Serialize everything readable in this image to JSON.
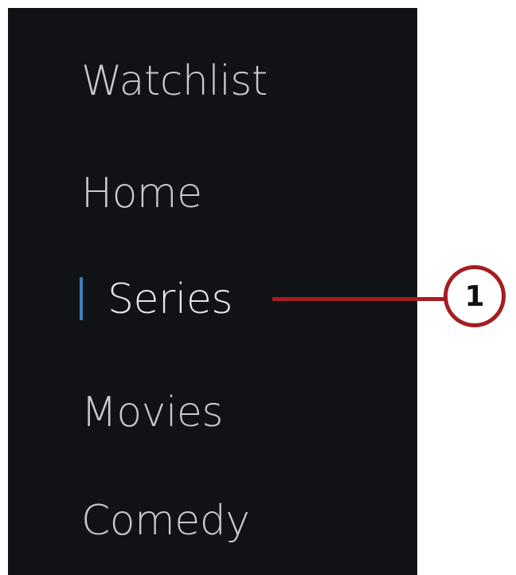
{
  "menu": {
    "items": [
      {
        "label": "Watchlist",
        "active": false
      },
      {
        "label": "Home",
        "active": false
      },
      {
        "label": "Series",
        "active": true
      },
      {
        "label": "Movies",
        "active": false
      },
      {
        "label": "Comedy",
        "active": false
      }
    ]
  },
  "callout": {
    "number": "1"
  },
  "colors": {
    "panel_background": "#111216",
    "text": "#c7c9ce",
    "active_indicator": "#3d7fc0",
    "callout": "#a41d22"
  }
}
